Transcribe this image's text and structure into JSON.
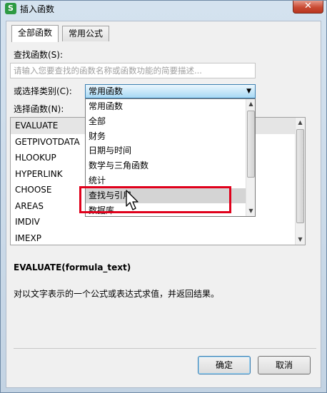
{
  "window": {
    "title": "插入函数",
    "app_icon_letter": "S",
    "close_symbol": "✕"
  },
  "tabs": [
    {
      "label": "全部函数",
      "active": true
    },
    {
      "label": "常用公式",
      "active": false
    }
  ],
  "search": {
    "label": "查找函数(S):",
    "placeholder": "请输入您要查找的函数名称或函数功能的简要描述..."
  },
  "category": {
    "label": "或选择类别(C):",
    "selected": "常用函数",
    "options": [
      "常用函数",
      "全部",
      "财务",
      "日期与时间",
      "数学与三角函数",
      "统计",
      "查找与引用",
      "数据库"
    ],
    "hovered_index": 6
  },
  "function_list": {
    "label": "选择函数(N):",
    "items": [
      "EVALUATE",
      "GETPIVOTDATA",
      "HLOOKUP",
      "HYPERLINK",
      "CHOOSE",
      "AREAS",
      "IMDIV",
      "IMEXP"
    ],
    "selected_index": 0
  },
  "details": {
    "signature": "EVALUATE(formula_text)",
    "description": "对以文字表示的一个公式或表达式求值，并返回结果。"
  },
  "buttons": {
    "ok": "确定",
    "cancel": "取消"
  },
  "colors": {
    "highlight_box": "#e0001b",
    "accent": "#3c7fb1"
  }
}
